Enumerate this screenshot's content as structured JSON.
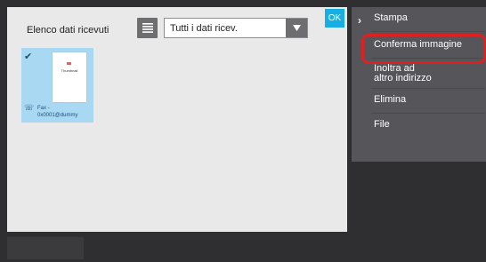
{
  "list_panel": {
    "title": "Elenco dati ricevuti",
    "filter_value": "Tutti i dati ricev.",
    "ok_label": "OK",
    "thumbnail": {
      "doc_text": "Thumbnail",
      "fax_label_line1": "Fax -",
      "fax_label_line2": "0x0001@dummy",
      "selected": true
    }
  },
  "action_menu": {
    "items": [
      {
        "label": "Stampa"
      },
      {
        "label": "Conferma immagine",
        "highlighted": true
      },
      {
        "label": "Inoltra ad\naltro indirizzo"
      },
      {
        "label": "Elimina"
      },
      {
        "label": "File"
      }
    ]
  },
  "icons": {
    "list": "list-icon",
    "dropdown": "chevron-down-icon",
    "check": "checkmark-icon",
    "fax": "fax-icon",
    "menu_collapse": "chevron-right-icon"
  },
  "colors": {
    "accent": "#17aee3",
    "highlight": "#e02020",
    "thumbnail_selected": "#a9d8f3",
    "menu_bg": "#56565a",
    "frame_bg": "#2f2f31"
  }
}
